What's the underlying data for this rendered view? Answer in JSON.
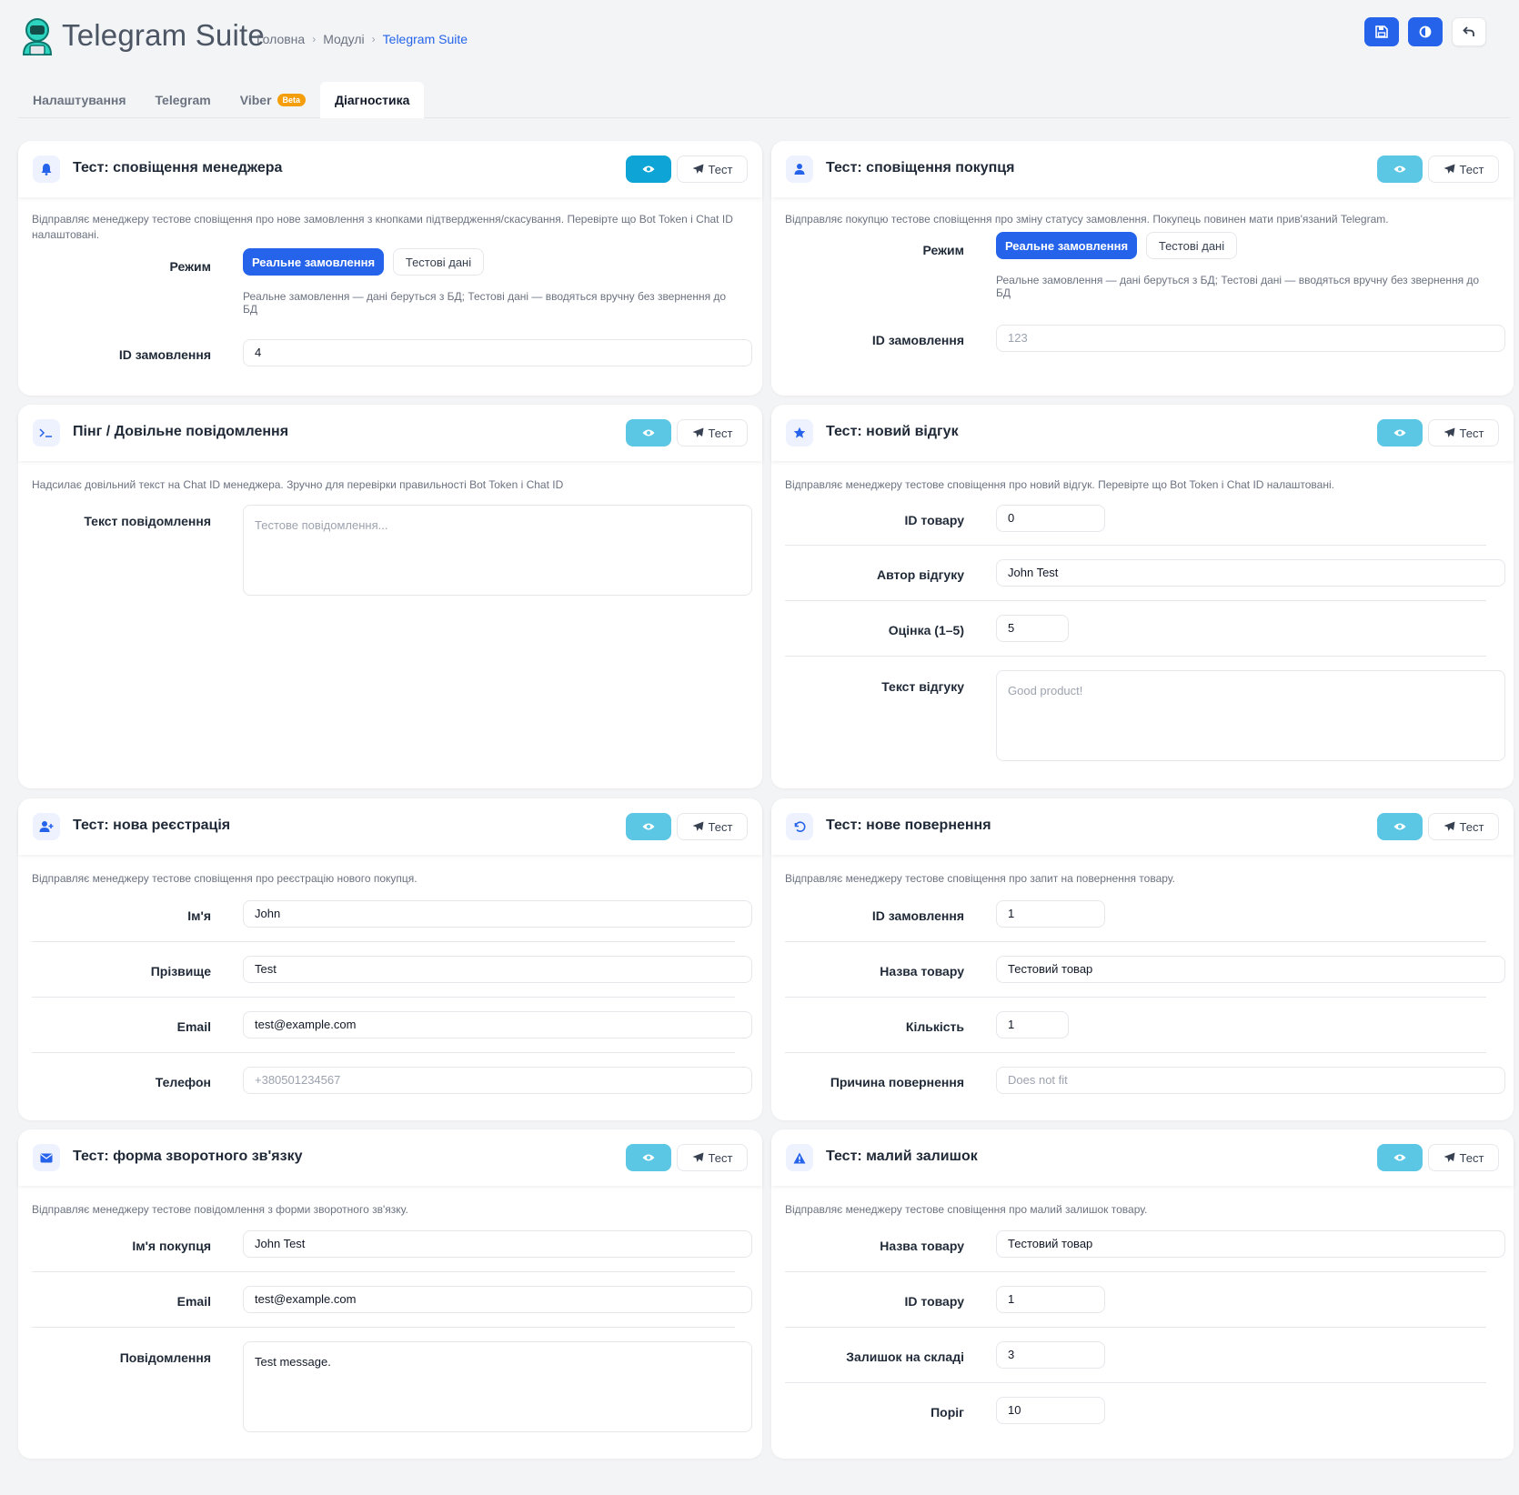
{
  "app": {
    "title": "Telegram Suite"
  },
  "breadcrumb": [
    "Головна",
    "Модулі",
    "Telegram Suite"
  ],
  "top_actions": {
    "save": "save-icon",
    "contrast": "contrast-icon",
    "back": "back-icon"
  },
  "tabs": [
    {
      "label": "Налаштування"
    },
    {
      "label": "Telegram"
    },
    {
      "label": "Viber",
      "badge": "Beta"
    },
    {
      "label": "Діагностика",
      "active": true
    }
  ],
  "common": {
    "test_label": "Тест"
  },
  "cards": {
    "manager": {
      "title": "Тест: сповіщення менеджера",
      "desc": "Відправляє менеджеру тестове сповіщення про нове замовлення з кнопками підтвердження/скасування. Перевірте що Bot Token і Chat ID налаштовані.",
      "mode_label": "Режим",
      "mode_real": "Реальне замовлення",
      "mode_test": "Тестові дані",
      "mode_hint": "Реальне замовлення — дані беруться з БД; Тестові дані — вводяться вручну без звернення до БД",
      "order_label": "ID замовлення",
      "order_value": "4"
    },
    "customer": {
      "title": "Тест: сповіщення покупця",
      "desc": "Відправляє покупцю тестове сповіщення про зміну статусу замовлення. Покупець повинен мати прив'язаний Telegram.",
      "mode_label": "Режим",
      "mode_real": "Реальне замовлення",
      "mode_test": "Тестові дані",
      "mode_hint": "Реальне замовлення — дані беруться з БД; Тестові дані — вводяться вручну без звернення до БД",
      "order_label": "ID замовлення",
      "order_placeholder": "123"
    },
    "ping": {
      "title": "Пінг / Довільне повідомлення",
      "desc": "Надсилає довільний текст на Chat ID менеджера. Зручно для перевірки правильності Bot Token і Chat ID",
      "text_label": "Текст повідомлення",
      "text_placeholder": "Тестове повідомлення..."
    },
    "review": {
      "title": "Тест: новий відгук",
      "desc": "Відправляє менеджеру тестове сповіщення про новий відгук. Перевірте що Bot Token і Chat ID налаштовані.",
      "product_label": "ID товару",
      "product_value": "0",
      "author_label": "Автор відгуку",
      "author_value": "John Test",
      "rating_label": "Оцінка (1–5)",
      "rating_value": "5",
      "text_label": "Текст відгуку",
      "text_placeholder": "Good product!"
    },
    "register": {
      "title": "Тест: нова реєстрація",
      "desc": "Відправляє менеджеру тестове сповіщення про реєстрацію нового покупця.",
      "first_label": "Ім'я",
      "first_value": "John",
      "last_label": "Прізвище",
      "last_value": "Test",
      "email_label": "Email",
      "email_value": "test@example.com",
      "phone_label": "Телефон",
      "phone_placeholder": "+380501234567"
    },
    "return": {
      "title": "Тест: нове повернення",
      "desc": "Відправляє менеджеру тестове сповіщення про запит на повернення товару.",
      "order_label": "ID замовлення",
      "order_value": "1",
      "name_label": "Назва товару",
      "name_value": "Тестовий товар",
      "qty_label": "Кількість",
      "qty_value": "1",
      "reason_label": "Причина повернення",
      "reason_placeholder": "Does not fit"
    },
    "contact": {
      "title": "Тест: форма зворотного зв'язку",
      "desc": "Відправляє менеджеру тестове повідомлення з форми зворотного зв'язку.",
      "name_label": "Ім'я покупця",
      "name_value": "John Test",
      "email_label": "Email",
      "email_value": "test@example.com",
      "msg_label": "Повідомлення",
      "msg_value": "Test message."
    },
    "stock": {
      "title": "Тест: малий залишок",
      "desc": "Відправляє менеджеру тестове сповіщення про малий залишок товару.",
      "name_label": "Назва товару",
      "name_value": "Тестовий товар",
      "product_label": "ID товару",
      "product_value": "1",
      "stock_label": "Залишок на складі",
      "stock_value": "3",
      "threshold_label": "Поріг",
      "threshold_value": "10"
    }
  },
  "colors": {
    "primary": "#2563eb",
    "info": "#5bc7e4",
    "info_strong": "#0ea5d6",
    "badge": "#f59e0b"
  }
}
